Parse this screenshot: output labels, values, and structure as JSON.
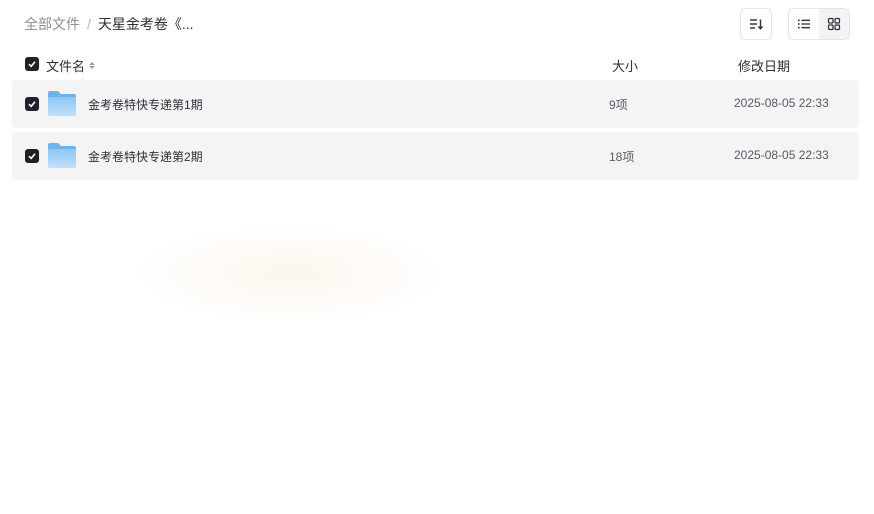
{
  "breadcrumb": {
    "root": "全部文件",
    "separator": "/",
    "current": "天星金考卷《..."
  },
  "toolbar": {
    "sort_icon": "sort-list-icon",
    "view_list_icon": "list-view-icon",
    "view_grid_icon": "grid-view-icon"
  },
  "table": {
    "headers": {
      "name": "文件名",
      "size": "大小",
      "date": "修改日期"
    },
    "rows": [
      {
        "name": "金考卷特快专递第1期",
        "size": "9项",
        "date": "2025-08-05 22:33",
        "checked": true,
        "icon": "folder-icon"
      },
      {
        "name": "金考卷特快专递第2期",
        "size": "18项",
        "date": "2025-08-05 22:33",
        "checked": true,
        "icon": "folder-icon"
      }
    ]
  },
  "colors": {
    "row_bg": "#f4f4f5",
    "checkbox": "#1f2329",
    "folder_light": "#a9d4f7",
    "folder_dark": "#6fb3ee"
  }
}
